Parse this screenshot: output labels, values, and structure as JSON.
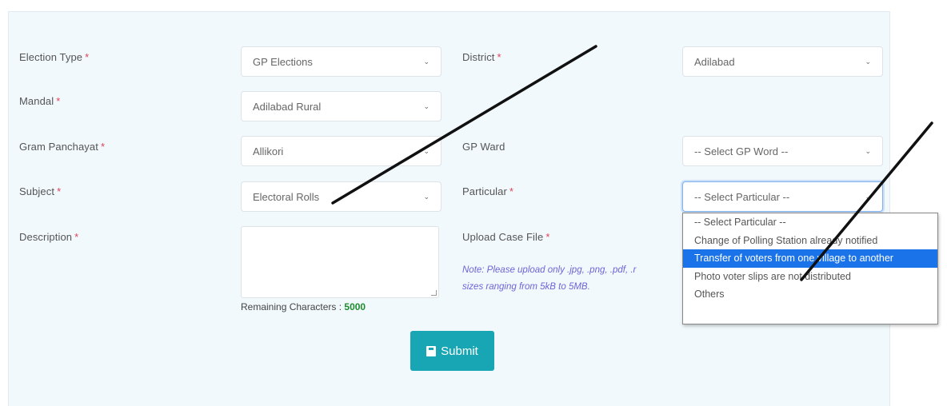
{
  "form": {
    "election_type": {
      "label": "Election Type",
      "value": "GP Elections"
    },
    "district": {
      "label": "District",
      "value": "Adilabad"
    },
    "mandal": {
      "label": "Mandal",
      "value": "Adilabad Rural"
    },
    "gram_panchayat": {
      "label": "Gram Panchayat",
      "value": "Allikori"
    },
    "gp_ward": {
      "label": "GP Ward",
      "value": "-- Select GP Word --"
    },
    "subject": {
      "label": "Subject",
      "value": "Electoral Rolls"
    },
    "particular": {
      "label": "Particular",
      "value": "-- Select Particular --",
      "options": [
        "-- Select Particular --",
        "Change of Polling Station already notified",
        "Transfer of voters from one village to another",
        "Photo voter slips are not distributed",
        "Others"
      ],
      "highlighted_index": 2
    },
    "description": {
      "label": "Description",
      "value": ""
    },
    "remaining": {
      "label": "Remaining Characters :",
      "count": "5000"
    },
    "upload": {
      "label": "Upload Case File",
      "note": "Note: Please upload only .jpg, .png, .pdf, .r",
      "note_line2": "sizes ranging from 5kB to 5MB."
    },
    "required_mark": "*",
    "submit_label": "Submit"
  },
  "colors": {
    "accent": "#18a6b4",
    "highlight": "#1a73e8",
    "required": "#e0435b",
    "count": "#1e8c2e",
    "note": "#6f63d8"
  }
}
